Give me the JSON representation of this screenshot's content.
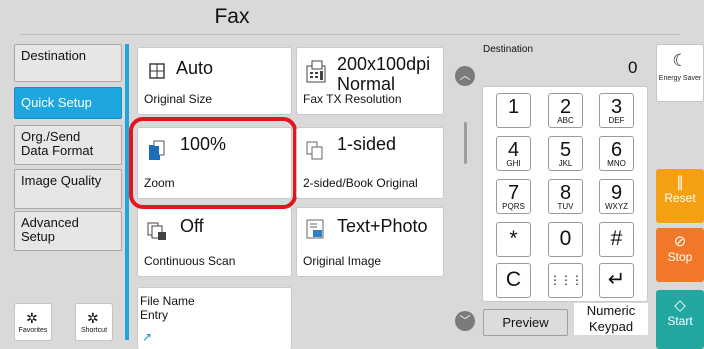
{
  "header": {
    "title": "Fax"
  },
  "nav": {
    "items": [
      {
        "label": "Destination",
        "active": false
      },
      {
        "label": "Quick Setup",
        "active": true
      },
      {
        "label": "Org./Send\nData Format",
        "active": false
      },
      {
        "label": "Image Quality",
        "active": false
      },
      {
        "label": "Advanced\nSetup",
        "active": false
      }
    ],
    "favorites_label": "Favorites",
    "shortcut_label": "Shortcut"
  },
  "tiles": {
    "original_size": {
      "value": "Auto",
      "label": "Original Size",
      "icon": "original-size-icon"
    },
    "fax_resolution": {
      "value": "200x100dpi\nNormal",
      "label": "Fax TX Resolution",
      "icon": "fax-resolution-icon"
    },
    "zoom": {
      "value": "100%",
      "label": "Zoom",
      "icon": "zoom-icon"
    },
    "duplex": {
      "value": "1-sided",
      "label": "2-sided/Book Original",
      "icon": "duplex-icon"
    },
    "continuous_scan": {
      "value": "Off",
      "label": "Continuous Scan",
      "icon": "continuous-scan-icon"
    },
    "original_image": {
      "value": "Text+Photo",
      "label": "Original Image",
      "icon": "original-image-icon"
    },
    "file_name": {
      "label": "File Name\nEntry",
      "icon": "arrow-icon"
    }
  },
  "destination": {
    "label": "Destination",
    "count": "0"
  },
  "keypad": {
    "keys": [
      {
        "num": "1",
        "sub": ""
      },
      {
        "num": "2",
        "sub": "ABC"
      },
      {
        "num": "3",
        "sub": "DEF"
      },
      {
        "num": "4",
        "sub": "GHI"
      },
      {
        "num": "5",
        "sub": "JKL"
      },
      {
        "num": "6",
        "sub": "MNO"
      },
      {
        "num": "7",
        "sub": "PQRS"
      },
      {
        "num": "8",
        "sub": "TUV"
      },
      {
        "num": "9",
        "sub": "WXYZ"
      },
      {
        "num": "*",
        "sub": ""
      },
      {
        "num": "0",
        "sub": ""
      },
      {
        "num": "#",
        "sub": ""
      },
      {
        "num": "C",
        "sub": ""
      },
      {
        "num": "⋮⋮⋮",
        "sub": ""
      },
      {
        "num": "↵",
        "sub": ""
      }
    ]
  },
  "bottom": {
    "preview_label": "Preview",
    "numeric_keypad_label": "Numeric\nKeypad"
  },
  "side": {
    "energy_saver_label": "Energy Saver",
    "reset_label": "Reset",
    "stop_label": "Stop",
    "start_label": "Start"
  },
  "colors": {
    "accent": "#1ea6df",
    "highlight": "#e2161e",
    "reset": "#f4a012",
    "stop": "#f07828",
    "start": "#22a8a0"
  }
}
